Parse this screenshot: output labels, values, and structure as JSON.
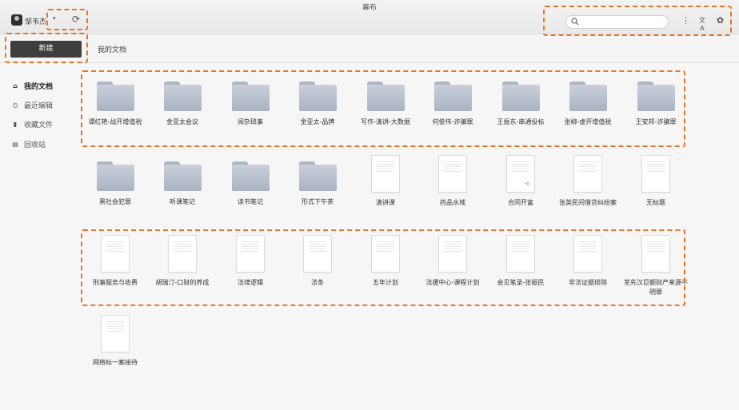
{
  "window": {
    "title": "幕布"
  },
  "user": {
    "name": "邹韦杰",
    "dropdown_glyph": "▾",
    "sync_glyph": "⟳"
  },
  "search": {
    "placeholder": "",
    "value": ""
  },
  "toolbar": {
    "more_glyph": "⋮",
    "translate_glyph": "文A",
    "settings_glyph": "✿"
  },
  "tabs": {
    "new_label": "新建",
    "mydocs_label": "我的文档"
  },
  "sidebar": {
    "items": [
      {
        "label": "我的文档",
        "icon": "home-icon",
        "glyph": "⌂"
      },
      {
        "label": "最近编辑",
        "icon": "clock-icon",
        "glyph": "◷"
      },
      {
        "label": "收藏文件",
        "icon": "bookmark-icon",
        "glyph": "▮"
      },
      {
        "label": "回收站",
        "icon": "trash-icon",
        "glyph": "▤"
      }
    ]
  },
  "rows": [
    [
      {
        "type": "folder",
        "label": "谭红艳-战开增值税"
      },
      {
        "type": "folder",
        "label": "金亚太会议"
      },
      {
        "type": "folder",
        "label": "阅杂琐事"
      },
      {
        "type": "folder",
        "label": "金亚太-品牌"
      },
      {
        "type": "folder",
        "label": "写作-演讲-大数据"
      },
      {
        "type": "folder",
        "label": "何俊伟-诈骗罪"
      },
      {
        "type": "folder",
        "label": "王振东-串通投标"
      },
      {
        "type": "folder",
        "label": "张柳-虚开增值税"
      },
      {
        "type": "folder",
        "label": "王安邦-诈骗罪"
      }
    ],
    [
      {
        "type": "folder",
        "label": "黑社会犯罪"
      },
      {
        "type": "folder",
        "label": "听课笔记"
      },
      {
        "type": "folder",
        "label": "读书笔记"
      },
      {
        "type": "folder",
        "label": "形式下午茶"
      },
      {
        "type": "doc",
        "label": "演讲课"
      },
      {
        "type": "doc",
        "label": "药品水域"
      },
      {
        "type": "doc",
        "label": "合同开富",
        "shared": true
      },
      {
        "type": "doc",
        "label": "张英民间借贷纠纷案"
      },
      {
        "type": "doc",
        "label": "无标题"
      }
    ],
    [
      {
        "type": "doc",
        "label": "刑事服务与收费"
      },
      {
        "type": "doc",
        "label": "胡瑞汀-口财的养成"
      },
      {
        "type": "doc",
        "label": "法律逻辑"
      },
      {
        "type": "doc",
        "label": "法条"
      },
      {
        "type": "doc",
        "label": "五年计划"
      },
      {
        "type": "doc",
        "label": "法援中心-课程计划"
      },
      {
        "type": "doc",
        "label": "会见笔录-张振民"
      },
      {
        "type": "doc",
        "label": "非法证据排除"
      },
      {
        "type": "doc",
        "label": "芜先汉巨额财产来源不明罪"
      }
    ],
    [
      {
        "type": "doc",
        "label": "网络标一案接待"
      }
    ]
  ],
  "colors": {
    "highlight": "#e8762a",
    "new_button": "#3e3e3e",
    "folder": "#b8c0cd"
  }
}
